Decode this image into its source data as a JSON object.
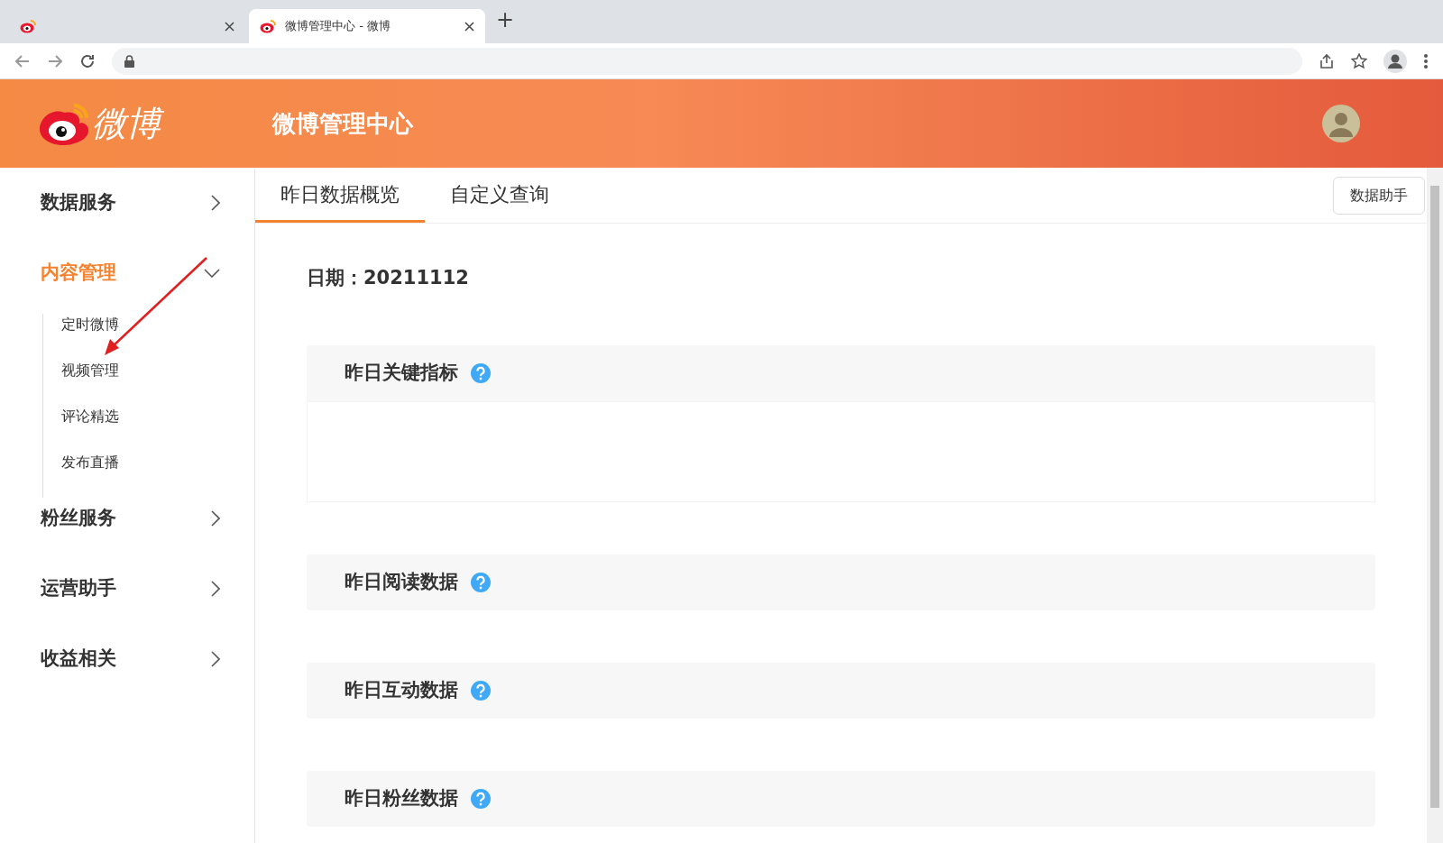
{
  "browser": {
    "tabs": [
      {
        "selected": false
      },
      {
        "title": "微博管理中心 - 微博",
        "selected": true
      }
    ],
    "new_tab": "+"
  },
  "header": {
    "logo_text": "微博",
    "title": "微博管理中心"
  },
  "sidebar": {
    "items": [
      {
        "label": "数据服务",
        "expanded": false,
        "selected": false
      },
      {
        "label": "内容管理",
        "expanded": true,
        "selected": true,
        "children": [
          {
            "label": "定时微博"
          },
          {
            "label": "视频管理"
          },
          {
            "label": "评论精选"
          },
          {
            "label": "发布直播"
          }
        ]
      },
      {
        "label": "粉丝服务",
        "expanded": false,
        "selected": false
      },
      {
        "label": "运营助手",
        "expanded": false,
        "selected": false
      },
      {
        "label": "收益相关",
        "expanded": false,
        "selected": false
      }
    ]
  },
  "tabs": [
    {
      "label": "昨日数据概览",
      "selected": true
    },
    {
      "label": "自定义查询",
      "selected": false
    }
  ],
  "helper_button": "数据助手",
  "date": "日期：20211112",
  "sections": [
    {
      "title": "昨日关键指标",
      "has_body": true
    },
    {
      "title": "昨日阅读数据",
      "has_body": false
    },
    {
      "title": "昨日互动数据",
      "has_body": false
    },
    {
      "title": "昨日粉丝数据",
      "has_body": false
    }
  ]
}
